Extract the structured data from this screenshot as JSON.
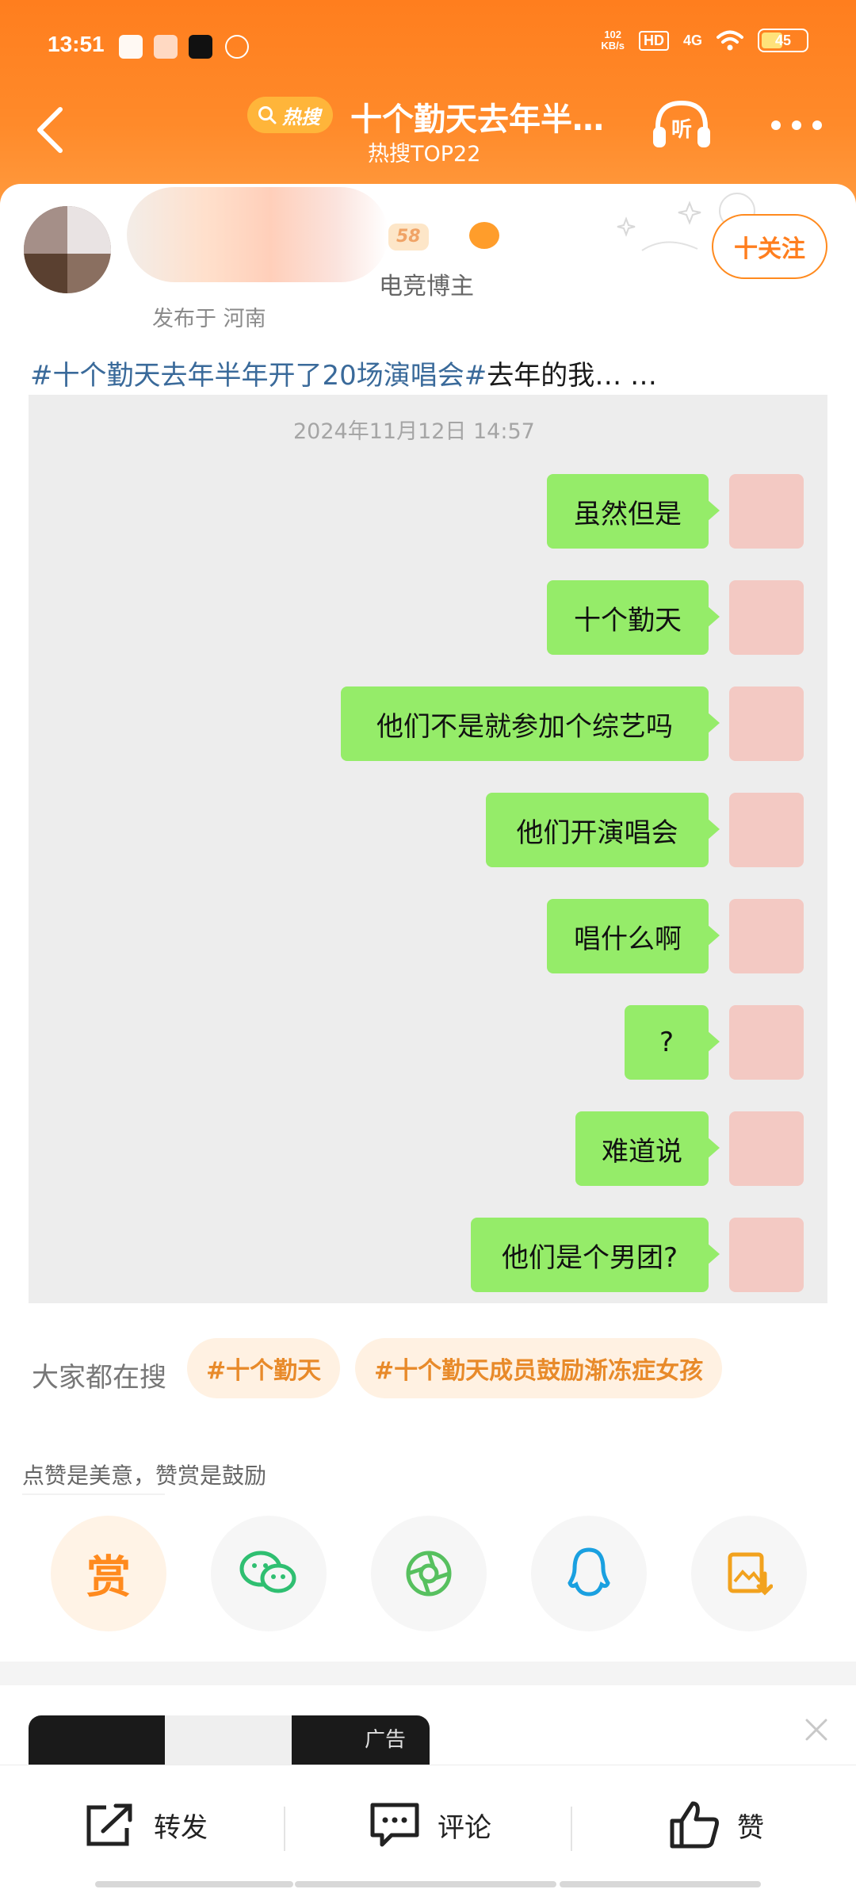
{
  "status_bar": {
    "time": "13:51",
    "net_speed_value": "102",
    "net_speed_unit": "KB/s",
    "hd": "HD",
    "network": "4G",
    "battery": "45"
  },
  "nav": {
    "hot_pill": "热搜",
    "title": "十个勤天去年半…",
    "subtitle": "热搜TOP22",
    "listen_label": "听"
  },
  "author": {
    "badge": "58",
    "role": "电竞博主",
    "location": "发布于 河南",
    "follow_label": "十关注"
  },
  "post": {
    "hashtag": "#十个勤天去年半年开了20场演唱会#",
    "text": "去年的我… …"
  },
  "chat": {
    "date": "2024年11月12日 14:57",
    "messages": [
      "虽然但是",
      "十个勤天",
      "他们不是就参加个综艺吗",
      "他们开演唱会",
      "唱什么啊",
      "?",
      "难道说",
      "他们是个男团?"
    ]
  },
  "searches": {
    "label": "大家都在搜",
    "items": [
      "#十个勤天",
      "#十个勤天成员鼓励渐冻症女孩"
    ]
  },
  "reward": {
    "hint": "点赞是美意，赞赏是鼓励",
    "reward_label": "赏"
  },
  "ad": {
    "label": "广告"
  },
  "bottom_bar": {
    "repost": "转发",
    "comment": "评论",
    "like": "赞"
  },
  "colors": {
    "header_orange": "#ff7e1e",
    "chat_bubble_green": "#95ec69",
    "hashtag_blue": "#3a6a9a",
    "chip_orange": "#e88a2a"
  }
}
